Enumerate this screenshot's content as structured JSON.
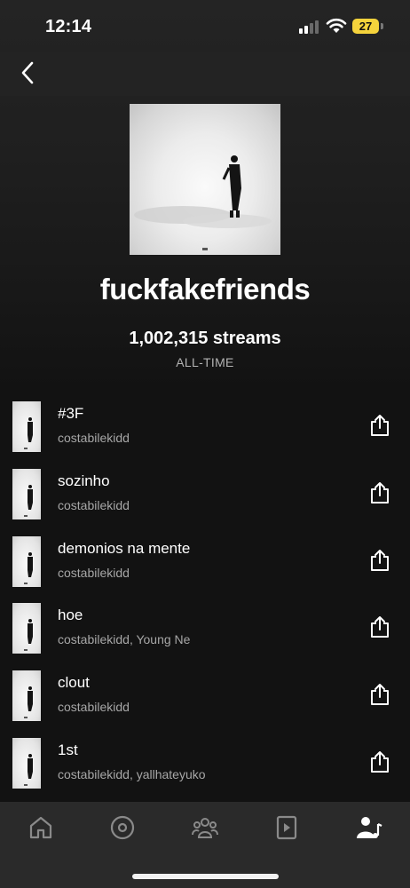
{
  "status_bar": {
    "time": "12:14",
    "battery": "27"
  },
  "album": {
    "title": "fuckfakefriends",
    "streams": "1,002,315 streams",
    "period": "ALL-TIME"
  },
  "tracks": [
    {
      "title": "#3F",
      "artist": "costabilekidd"
    },
    {
      "title": "sozinho",
      "artist": "costabilekidd"
    },
    {
      "title": "demonios na mente",
      "artist": "costabilekidd"
    },
    {
      "title": "hoe",
      "artist": "costabilekidd, Young Ne"
    },
    {
      "title": "clout",
      "artist": "costabilekidd"
    },
    {
      "title": "1st",
      "artist": "costabilekidd, yallhateyuko"
    }
  ],
  "tabs": [
    {
      "icon": "home-icon"
    },
    {
      "icon": "disc-icon"
    },
    {
      "icon": "audience-icon"
    },
    {
      "icon": "video-icon"
    },
    {
      "icon": "artist-music-icon",
      "active": true
    }
  ],
  "colors": {
    "background": "#121212",
    "secondary_text": "#a7a7a7",
    "battery": "#f5d33c",
    "tab_inactive": "#8a8a8a"
  }
}
